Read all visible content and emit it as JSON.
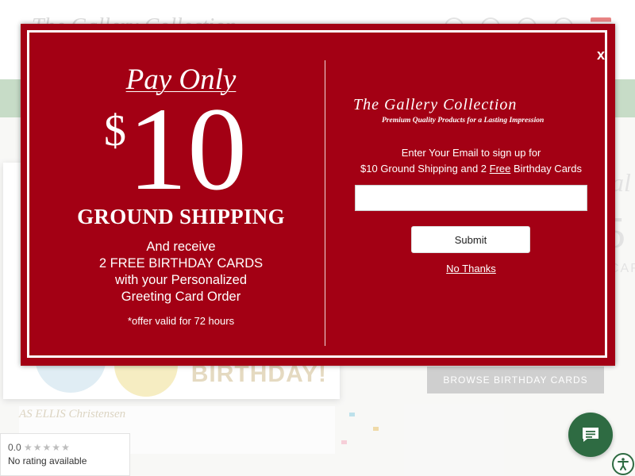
{
  "background": {
    "logo_text": "The Gallery Collection",
    "card_text": "BIRTHDAY!",
    "card_names": "AS ELLIS   Christensen",
    "right_heading": "al",
    "right_big": "5",
    "right_small": "CAR",
    "browse_label": "BROWSE BIRTHDAY CARDS"
  },
  "modal": {
    "close_label": "x",
    "left": {
      "pay_only": "Pay Only",
      "dollar": "$",
      "amount": "10",
      "ground_shipping": "GROUND SHIPPING",
      "receive_lines": [
        "And receive",
        "2 FREE BIRTHDAY CARDS",
        "with your Personalized",
        "Greeting Card Order"
      ],
      "offer_note": "*offer valid for 72 hours"
    },
    "right": {
      "brand_name": "The Gallery Collection",
      "brand_tagline": "Premium Quality Products for a Lasting Impression",
      "prompt_line1": "Enter Your Email to sign up for",
      "prompt_line2_before": "$10 Ground Shipping and 2 ",
      "prompt_line2_free": "Free",
      "prompt_line2_after": " Birthday Cards",
      "email_value": "",
      "email_placeholder": "",
      "submit_label": "Submit",
      "no_thanks_label": "No Thanks"
    }
  },
  "rating_widget": {
    "score": "0.0",
    "stars": "★★★★★",
    "status": "No rating available"
  },
  "colors": {
    "modal_red": "#a30014",
    "menu_green": "#a9c9aa",
    "chat_green": "#2e6b42"
  },
  "icons": {
    "chat": "chat-bubble-icon",
    "accessibility": "accessibility-icon"
  }
}
